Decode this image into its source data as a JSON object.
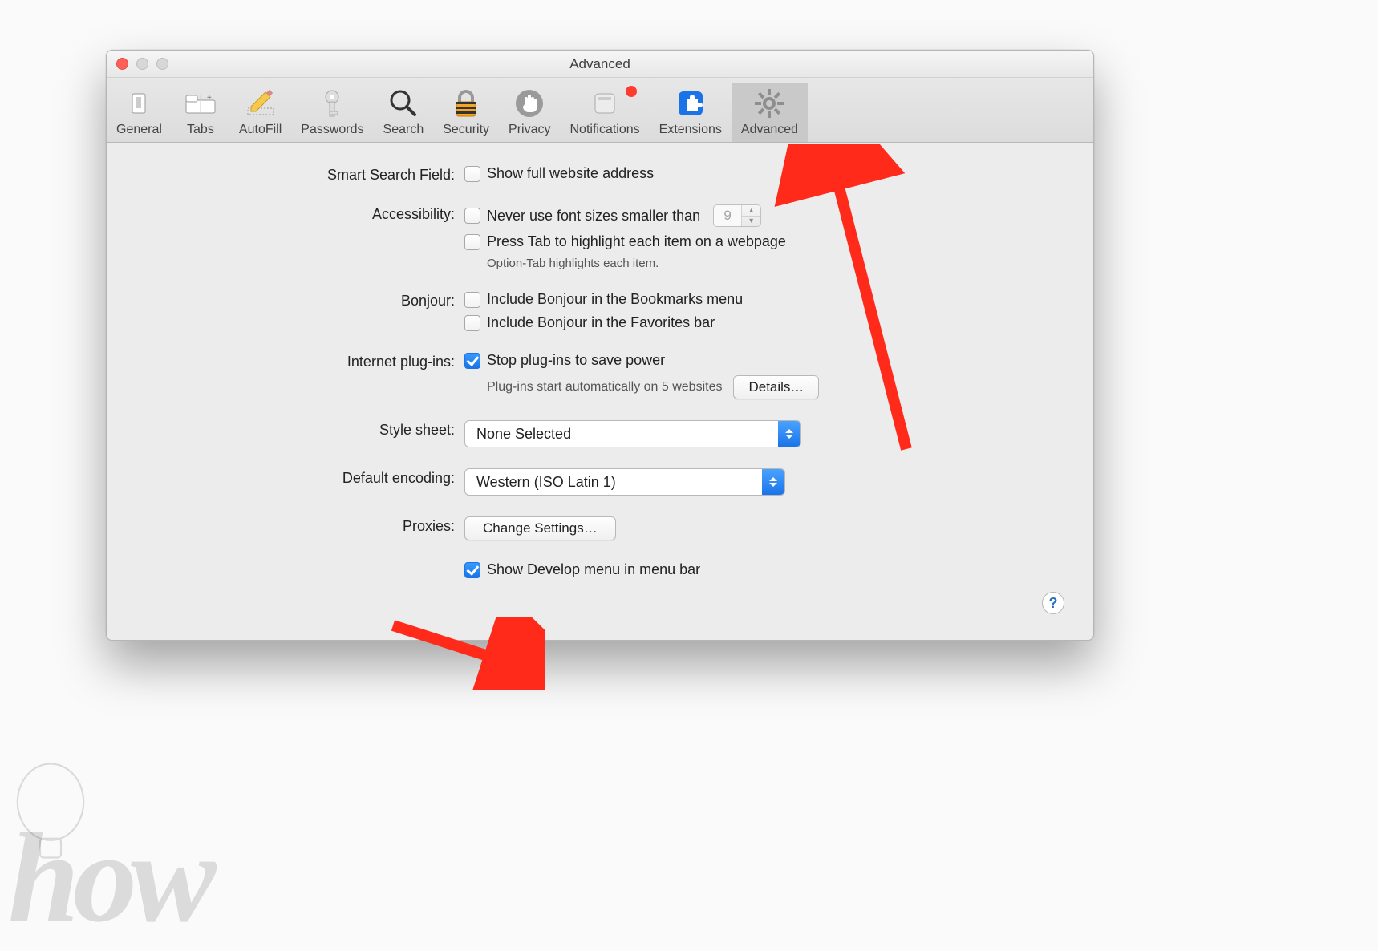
{
  "window": {
    "title": "Advanced"
  },
  "toolbar": [
    {
      "id": "general",
      "label": "General"
    },
    {
      "id": "tabs",
      "label": "Tabs"
    },
    {
      "id": "autofill",
      "label": "AutoFill"
    },
    {
      "id": "passwords",
      "label": "Passwords"
    },
    {
      "id": "search",
      "label": "Search"
    },
    {
      "id": "security",
      "label": "Security"
    },
    {
      "id": "privacy",
      "label": "Privacy"
    },
    {
      "id": "notifications",
      "label": "Notifications",
      "badge": true
    },
    {
      "id": "extensions",
      "label": "Extensions"
    },
    {
      "id": "advanced",
      "label": "Advanced",
      "active": true
    }
  ],
  "sections": {
    "smart_search": {
      "label": "Smart Search Field:",
      "show_full_url": {
        "text": "Show full website address",
        "checked": false
      }
    },
    "accessibility": {
      "label": "Accessibility:",
      "min_font": {
        "text": "Never use font sizes smaller than",
        "checked": false,
        "value": "9"
      },
      "tab_highlight": {
        "text": "Press Tab to highlight each item on a webpage",
        "checked": false
      },
      "hint": "Option-Tab highlights each item."
    },
    "bonjour": {
      "label": "Bonjour:",
      "bookmarks": {
        "text": "Include Bonjour in the Bookmarks menu",
        "checked": false
      },
      "favorites": {
        "text": "Include Bonjour in the Favorites bar",
        "checked": false
      }
    },
    "plugins": {
      "label": "Internet plug-ins:",
      "stop_power": {
        "text": "Stop plug-ins to save power",
        "checked": true
      },
      "hint": "Plug-ins start automatically on 5 websites",
      "details_btn": "Details…"
    },
    "stylesheet": {
      "label": "Style sheet:",
      "value": "None Selected"
    },
    "encoding": {
      "label": "Default encoding:",
      "value": "Western (ISO Latin 1)"
    },
    "proxies": {
      "label": "Proxies:",
      "button": "Change Settings…"
    },
    "develop": {
      "text": "Show Develop menu in menu bar",
      "checked": true
    }
  },
  "help": "?",
  "watermark": "how"
}
